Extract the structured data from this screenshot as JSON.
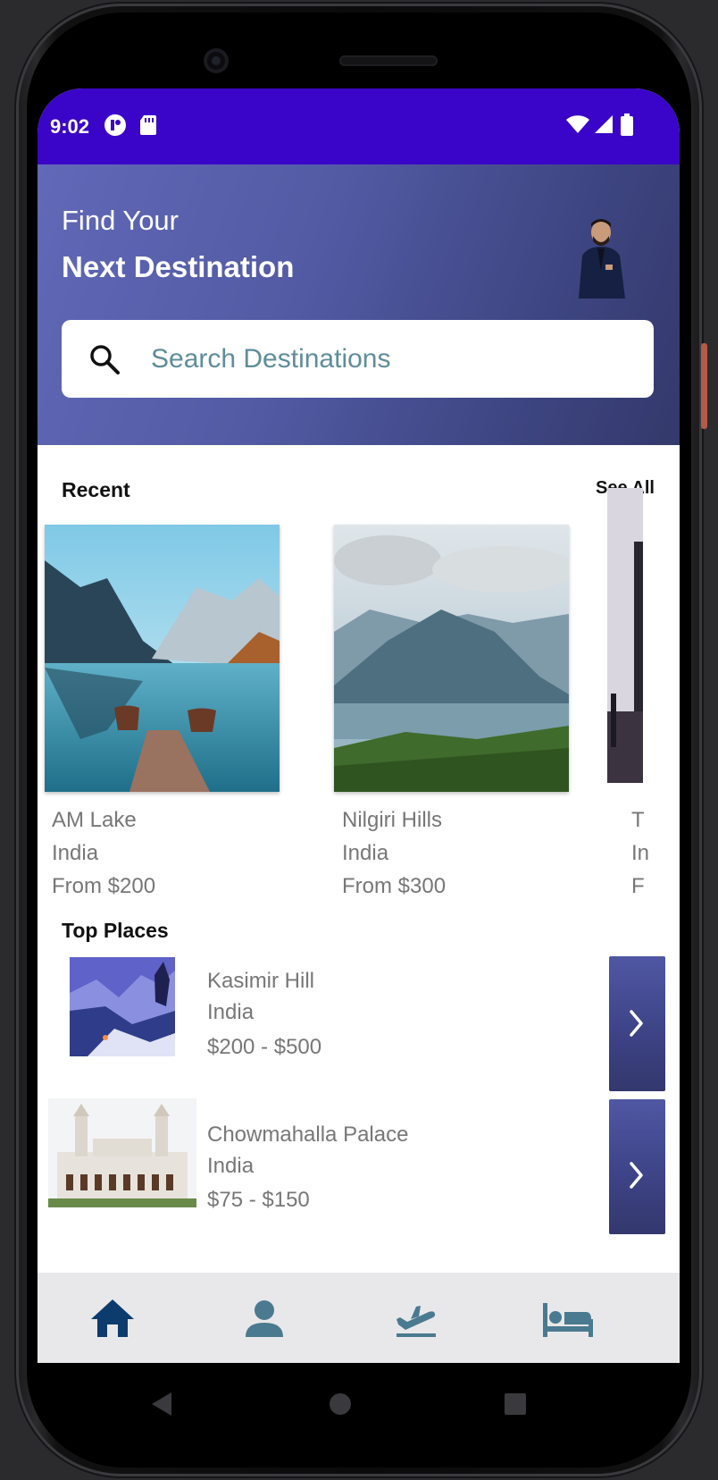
{
  "status": {
    "time": "9:02"
  },
  "header": {
    "line1": "Find Your",
    "line2": "Next Destination"
  },
  "search": {
    "placeholder": "Search Destinations"
  },
  "recent": {
    "title": "Recent",
    "see_all": "See All",
    "cards": [
      {
        "name": "AM Lake",
        "country": "India",
        "price": "From $200"
      },
      {
        "name": "Nilgiri Hills",
        "country": "India",
        "price": "From $300"
      },
      {
        "name": "T",
        "country": "In",
        "price": "F"
      }
    ]
  },
  "top_places": {
    "title": "Top Places",
    "items": [
      {
        "name": "Kasimir Hill",
        "country": "India",
        "price": "$200 - $500"
      },
      {
        "name": "Chowmahalla Palace",
        "country": "India",
        "price": "$75 - $150"
      }
    ]
  },
  "bottom_nav": {
    "items": [
      {
        "icon": "home-icon",
        "active": true
      },
      {
        "icon": "person-icon",
        "active": false
      },
      {
        "icon": "flight-icon",
        "active": false
      },
      {
        "icon": "hotel-icon",
        "active": false
      }
    ]
  },
  "colors": {
    "status_bar": "#3a05c8",
    "header_start": "#6169b8",
    "header_end": "#34396b",
    "nav_active": "#0c3c6e",
    "nav_inactive": "#4a7a90"
  }
}
